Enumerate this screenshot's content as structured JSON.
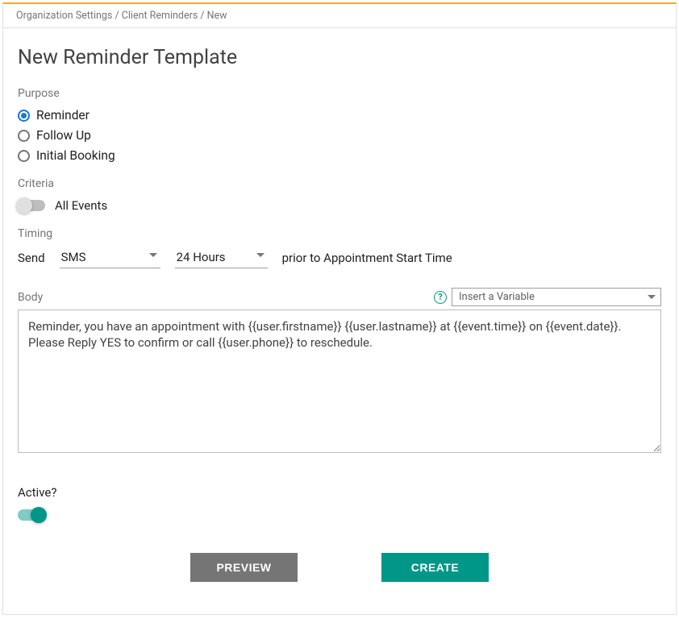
{
  "breadcrumb": "Organization Settings / Client Reminders / New",
  "title": "New Reminder Template",
  "purpose": {
    "label": "Purpose",
    "options": [
      "Reminder",
      "Follow Up",
      "Initial Booking"
    ],
    "selected": 0
  },
  "criteria": {
    "label": "Criteria",
    "toggle_label": "All Events",
    "on": false
  },
  "timing": {
    "label": "Timing",
    "send_label": "Send",
    "method": "SMS",
    "interval": "24 Hours",
    "suffix": "prior to Appointment Start Time"
  },
  "body": {
    "label": "Body",
    "variable_placeholder": "Insert a Variable",
    "text": "Reminder, you have an appointment with {{user.firstname}} {{user.lastname}} at {{event.time}} on {{event.date}}.  Please Reply YES to confirm or call {{user.phone}} to reschedule."
  },
  "active": {
    "label": "Active?",
    "on": true
  },
  "buttons": {
    "preview": "PREVIEW",
    "create": "CREATE"
  }
}
